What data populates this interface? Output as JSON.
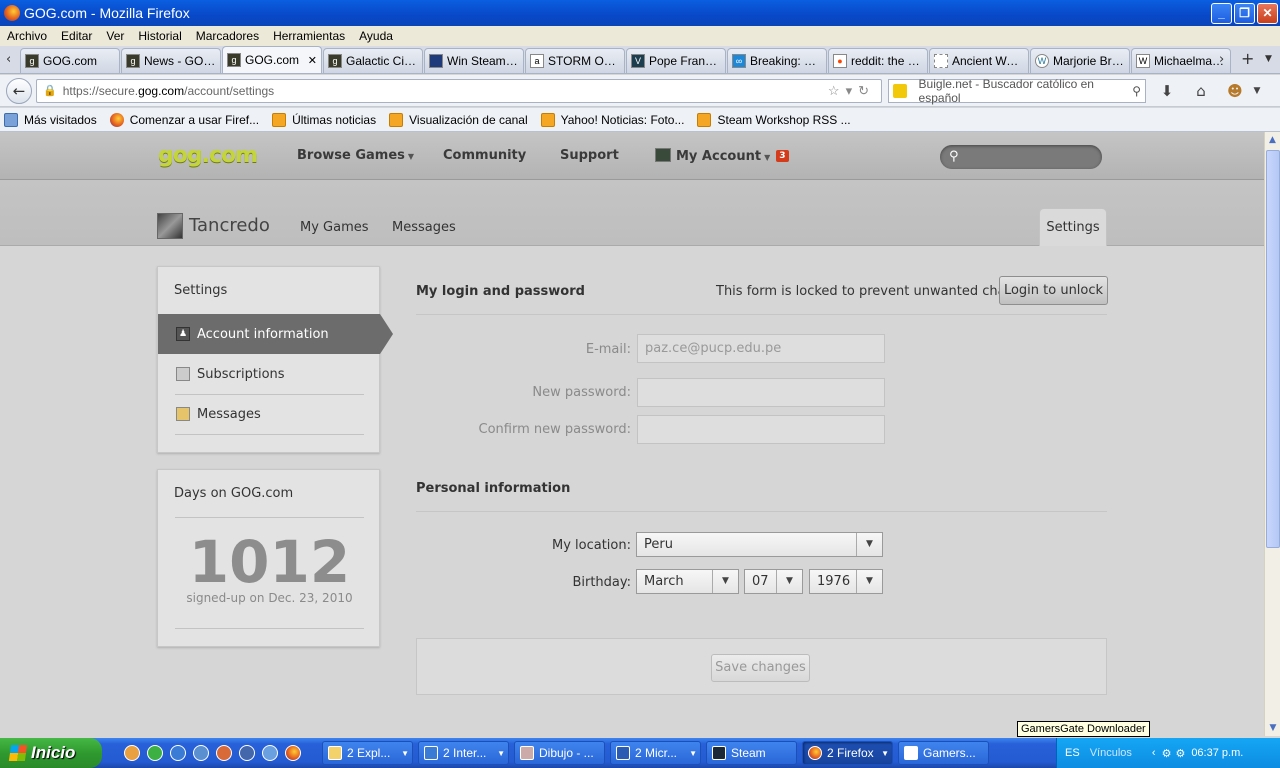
{
  "window": {
    "title": "GOG.com - Mozilla Firefox"
  },
  "menu": [
    "Archivo",
    "Editar",
    "Ver",
    "Historial",
    "Marcadores",
    "Herramientas",
    "Ayuda"
  ],
  "tabs": [
    {
      "label": "GOG.com",
      "icon": "gog-icon"
    },
    {
      "label": "News - GOG....",
      "icon": "gog-icon"
    },
    {
      "label": "GOG.com",
      "icon": "gog-icon",
      "active": true
    },
    {
      "label": "Galactic Civili...",
      "icon": "gog-icon"
    },
    {
      "label": "Win Steam Gi...",
      "icon": "steam-icon"
    },
    {
      "label": "STORM OF S...",
      "icon": "amazon-icon"
    },
    {
      "label": "Pope Francis'...",
      "icon": "v-icon"
    },
    {
      "label": "Breaking: Jes...",
      "icon": "infinity-icon"
    },
    {
      "label": "reddit: the fr...",
      "icon": "reddit-icon"
    },
    {
      "label": "Ancient Warf...",
      "icon": "blank-page-icon"
    },
    {
      "label": "Marjorie Bruc...",
      "icon": "wordpress-icon"
    },
    {
      "label": "Michaelmas - ...",
      "icon": "wikipedia-icon"
    }
  ],
  "urlbar": {
    "prefix": "https://secure.",
    "domain": "gog.com",
    "path": "/account/settings"
  },
  "searchbar": {
    "placeholder": "Buigle.net - Buscador católico en español"
  },
  "bookmarks": [
    "Más visitados",
    "Comenzar a usar Firef...",
    "Últimas noticias",
    "Visualización de canal",
    "Yahoo! Noticias: Foto...",
    "Steam Workshop RSS ..."
  ],
  "site": {
    "logo": "gog.com",
    "nav": {
      "browse": "Browse Games",
      "community": "Community",
      "support": "Support",
      "account": "My Account",
      "account_badge": "3"
    },
    "user": {
      "name": "Tancredo"
    },
    "subnav": {
      "my_games": "My Games",
      "messages": "Messages",
      "settings": "Settings"
    },
    "sidebar": {
      "title": "Settings",
      "items": [
        "Account information",
        "Subscriptions",
        "Messages"
      ]
    },
    "days": {
      "title": "Days on GOG.com",
      "count": "1012",
      "since": "signed-up on Dec. 23, 2010"
    },
    "login": {
      "title": "My login and password",
      "locked_msg": "This form is locked to prevent unwanted changes.",
      "unlock_label": "Login to unlock",
      "email_label": "E-mail:",
      "email_value": "paz.ce@pucp.edu.pe",
      "new_pw_label": "New password:",
      "confirm_pw_label": "Confirm new password:"
    },
    "personal": {
      "title": "Personal information",
      "location_label": "My location:",
      "location_value": "Peru",
      "birthday_label": "Birthday:",
      "month": "March",
      "day": "07",
      "year": "1976"
    },
    "save_label": "Save changes"
  },
  "tooltip": "GamersGate Downloader",
  "taskbar": {
    "start": "Inicio",
    "items": [
      "2 Expl...",
      "2 Inter...",
      "Dibujo - ...",
      "2 Micr...",
      "Steam",
      "2 Firefox",
      "Gamers..."
    ],
    "lang": "ES",
    "links": "Vínculos",
    "time": "06:37 p.m."
  }
}
